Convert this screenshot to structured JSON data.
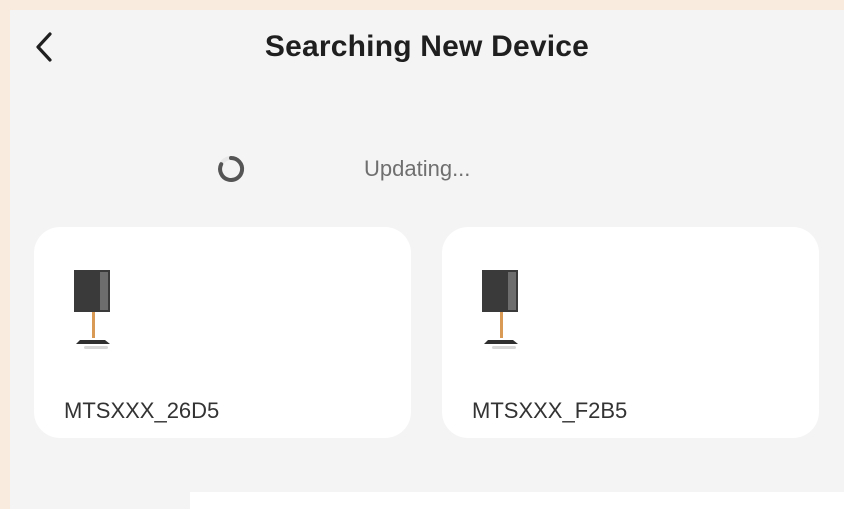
{
  "header": {
    "title": "Searching New Device",
    "back_icon": "chevron-left-icon"
  },
  "status": {
    "icon": "loading-spinner-icon",
    "text": "Updating..."
  },
  "devices": [
    {
      "icon": "tv-stand-icon",
      "name": "MTSXXX_26D5"
    },
    {
      "icon": "tv-stand-icon",
      "name": "MTSXXX_F2B5"
    }
  ],
  "colors": {
    "outer_background": "#f9ecdf",
    "screen_background": "#f4f4f4",
    "card_background": "#ffffff",
    "title_text": "#1f1f1f",
    "status_text": "#6f6f6f",
    "device_screen": "#3a3a3a",
    "device_stand": "#d99a55"
  }
}
